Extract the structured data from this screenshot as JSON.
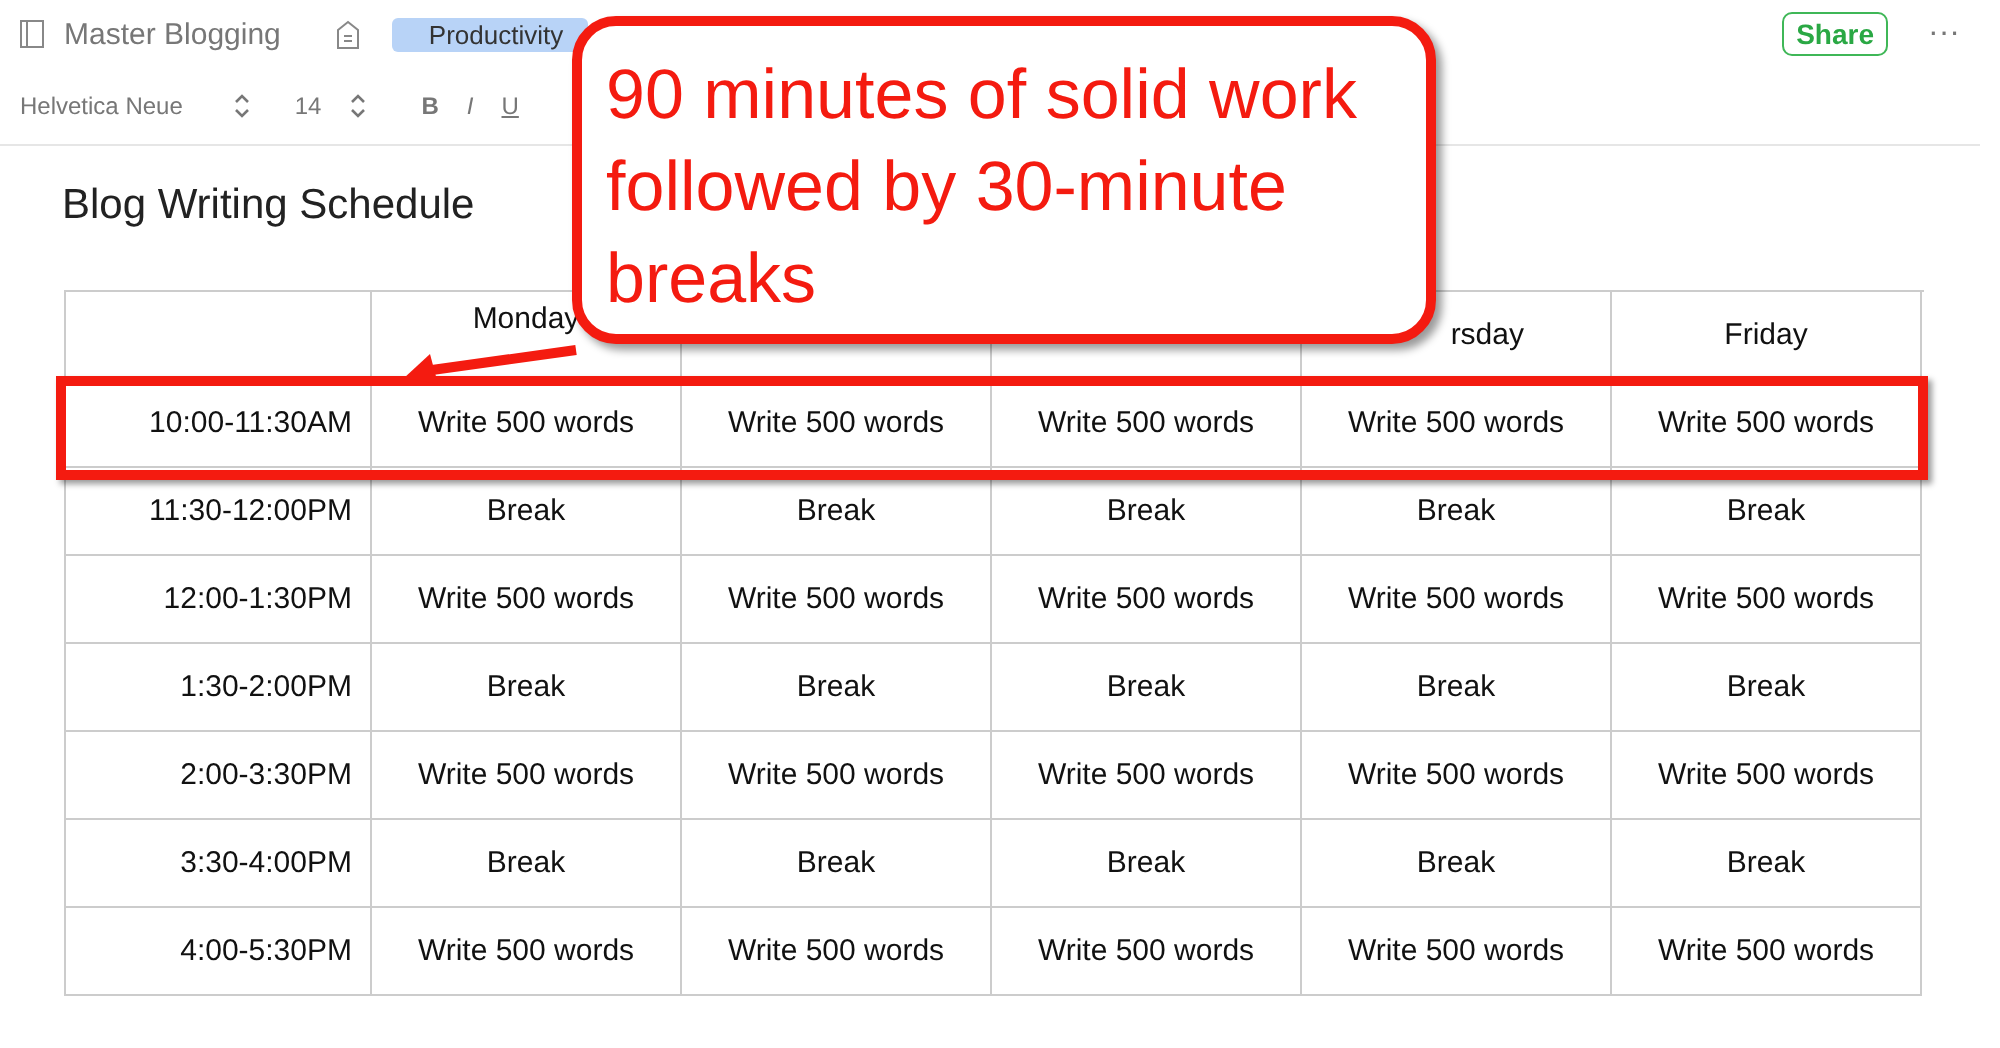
{
  "header": {
    "notebook": "Master Blogging",
    "tag": "Productivity",
    "share": "Share",
    "more": "···"
  },
  "toolbar": {
    "font": "Helvetica Neue",
    "size": "14",
    "bold": "B",
    "italic": "I",
    "underline": "U"
  },
  "title": "Blog Writing Schedule",
  "table": {
    "headers": {
      "column_2": "Monday",
      "column_5": "rsday",
      "column_6": "Friday"
    },
    "rows": [
      {
        "time": "10:00-11:30AM",
        "cells": [
          "Write 500 words",
          "Write 500 words",
          "Write 500 words",
          "Write 500 words",
          "Write 500 words"
        ],
        "highlighted": true
      },
      {
        "time": "11:30-12:00PM",
        "cells": [
          "Break",
          "Break",
          "Break",
          "Break",
          "Break"
        ],
        "highlighted": false
      },
      {
        "time": "12:00-1:30PM",
        "cells": [
          "Write 500 words",
          "Write 500 words",
          "Write 500 words",
          "Write 500 words",
          "Write 500 words"
        ],
        "highlighted": false
      },
      {
        "time": "1:30-2:00PM",
        "cells": [
          "Break",
          "Break",
          "Break",
          "Break",
          "Break"
        ],
        "highlighted": false
      },
      {
        "time": "2:00-3:30PM",
        "cells": [
          "Write 500 words",
          "Write 500 words",
          "Write 500 words",
          "Write 500 words",
          "Write 500 words"
        ],
        "highlighted": false
      },
      {
        "time": "3:30-4:00PM",
        "cells": [
          "Break",
          "Break",
          "Break",
          "Break",
          "Break"
        ],
        "highlighted": false
      },
      {
        "time": "4:00-5:30PM",
        "cells": [
          "Write 500 words",
          "Write 500 words",
          "Write 500 words",
          "Write 500 words",
          "Write 500 words"
        ],
        "highlighted": false
      }
    ]
  },
  "callout": {
    "lines": [
      "90 minutes of solid work",
      "followed by 30-minute",
      "breaks"
    ]
  }
}
